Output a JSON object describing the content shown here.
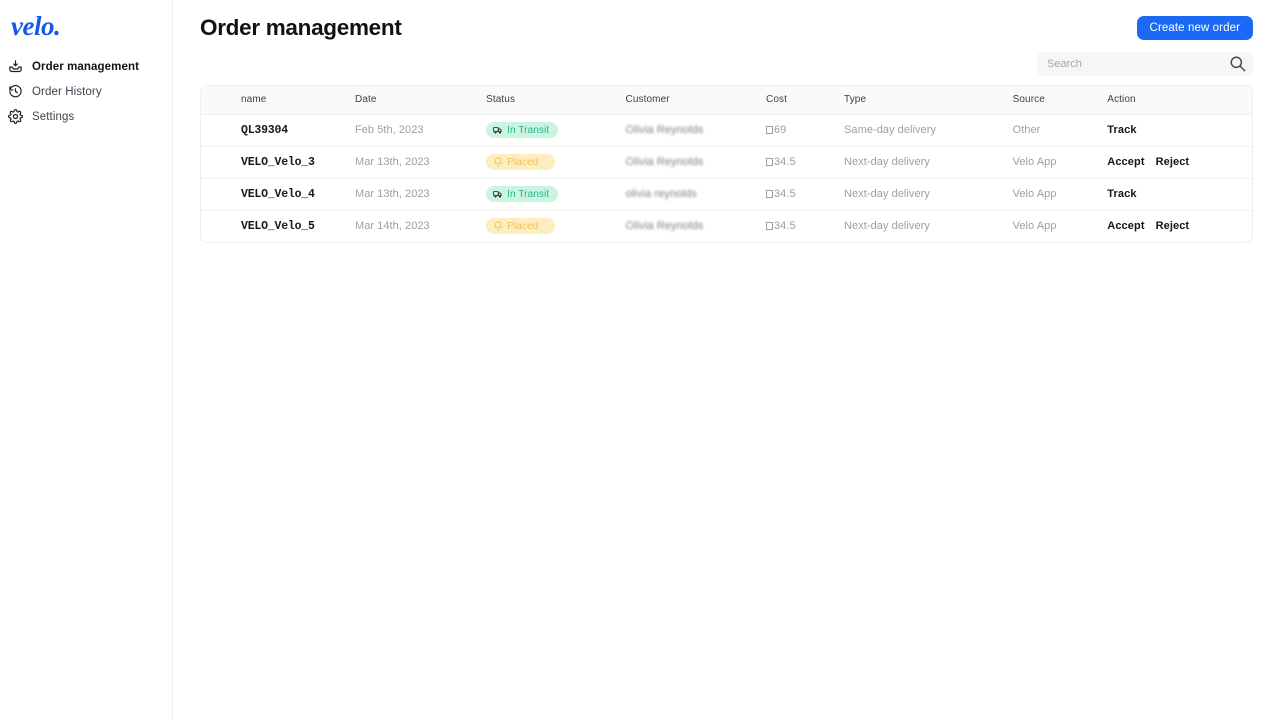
{
  "brand": {
    "logo_text": "velo.",
    "logo_color": "#1858e8"
  },
  "sidebar": {
    "items": [
      {
        "label": "Order management",
        "icon": "inbox-download-icon",
        "active": true
      },
      {
        "label": "Order History",
        "icon": "clock-history-icon",
        "active": false
      },
      {
        "label": "Settings",
        "icon": "gear-icon",
        "active": false
      }
    ]
  },
  "header": {
    "title": "Order management",
    "create_button": "Create new order",
    "create_button_color": "#1b69f5"
  },
  "search": {
    "value": "",
    "placeholder": "Search",
    "icon": "search-icon"
  },
  "table": {
    "columns": [
      "name",
      "Date",
      "Status",
      "Customer",
      "Cost",
      "Type",
      "Source",
      "Action"
    ],
    "rows": [
      {
        "name": "QL39304",
        "date": "Feb 5th, 2023",
        "status": "In Transit",
        "status_kind": "transit",
        "customer": "Olivia Reynolds",
        "cost": "69",
        "cost_symbol": "missing-glyph",
        "type": "Same-day delivery",
        "source": "Other",
        "actions": [
          "Track"
        ]
      },
      {
        "name": "VELO_Velo_3",
        "date": "Mar 13th, 2023",
        "status": "Placed",
        "status_kind": "placed",
        "customer": "Olivia Reynolds",
        "cost": "34.5",
        "cost_symbol": "missing-glyph",
        "type": "Next-day delivery",
        "source": "Velo App",
        "actions": [
          "Accept",
          "Reject"
        ]
      },
      {
        "name": "VELO_Velo_4",
        "date": "Mar 13th, 2023",
        "status": "In Transit",
        "status_kind": "transit",
        "customer": "olivia reynolds",
        "cost": "34.5",
        "cost_symbol": "missing-glyph",
        "type": "Next-day delivery",
        "source": "Velo App",
        "actions": [
          "Track"
        ]
      },
      {
        "name": "VELO_Velo_5",
        "date": "Mar 14th, 2023",
        "status": "Placed",
        "status_kind": "placed",
        "customer": "Olivia Reynolds",
        "cost": "34.5",
        "cost_symbol": "missing-glyph",
        "type": "Next-day delivery",
        "source": "Velo App",
        "actions": [
          "Accept",
          "Reject"
        ]
      }
    ]
  },
  "badge_colors": {
    "transit_bg": "#c9f4e0",
    "transit_fg": "#2ab586",
    "placed_bg": "#fdeec0",
    "placed_fg": "#f0bf4a"
  }
}
